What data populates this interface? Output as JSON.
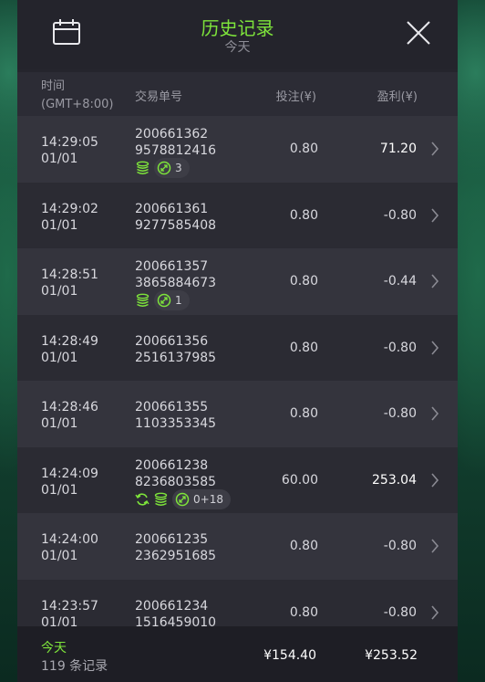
{
  "header": {
    "title": "历史记录",
    "subtitle": "今天"
  },
  "columns": {
    "time_label": "时间",
    "time_tz": "(GMT+8:00)",
    "order": "交易单号",
    "bet": "投注(¥)",
    "profit": "盈利(¥)"
  },
  "rows": [
    {
      "time": "14:29:05",
      "date": "01/01",
      "order1": "200661362",
      "order2": "9578812416",
      "bet": "0.80",
      "profit": "71.20",
      "positive": true,
      "badge": "3",
      "refresh": false
    },
    {
      "time": "14:29:02",
      "date": "01/01",
      "order1": "200661361",
      "order2": "9277585408",
      "bet": "0.80",
      "profit": "-0.80",
      "positive": false
    },
    {
      "time": "14:28:51",
      "date": "01/01",
      "order1": "200661357",
      "order2": "3865884673",
      "bet": "0.80",
      "profit": "-0.44",
      "positive": false,
      "badge": "1",
      "refresh": false
    },
    {
      "time": "14:28:49",
      "date": "01/01",
      "order1": "200661356",
      "order2": "2516137985",
      "bet": "0.80",
      "profit": "-0.80",
      "positive": false
    },
    {
      "time": "14:28:46",
      "date": "01/01",
      "order1": "200661355",
      "order2": "1103353345",
      "bet": "0.80",
      "profit": "-0.80",
      "positive": false
    },
    {
      "time": "14:24:09",
      "date": "01/01",
      "order1": "200661238",
      "order2": "8236803585",
      "bet": "60.00",
      "profit": "253.04",
      "positive": true,
      "badge": "0+18",
      "refresh": true
    },
    {
      "time": "14:24:00",
      "date": "01/01",
      "order1": "200661235",
      "order2": "2362951685",
      "bet": "0.80",
      "profit": "-0.80",
      "positive": false
    },
    {
      "time": "14:23:57",
      "date": "01/01",
      "order1": "200661234",
      "order2": "1516459010",
      "bet": "0.80",
      "profit": "-0.80",
      "positive": false
    }
  ],
  "footer": {
    "today": "今天",
    "count": "119 条记录",
    "total_bet": "¥154.40",
    "total_profit": "¥253.52"
  },
  "colors": {
    "accent": "#7ee43b",
    "panel": "#25252d"
  }
}
